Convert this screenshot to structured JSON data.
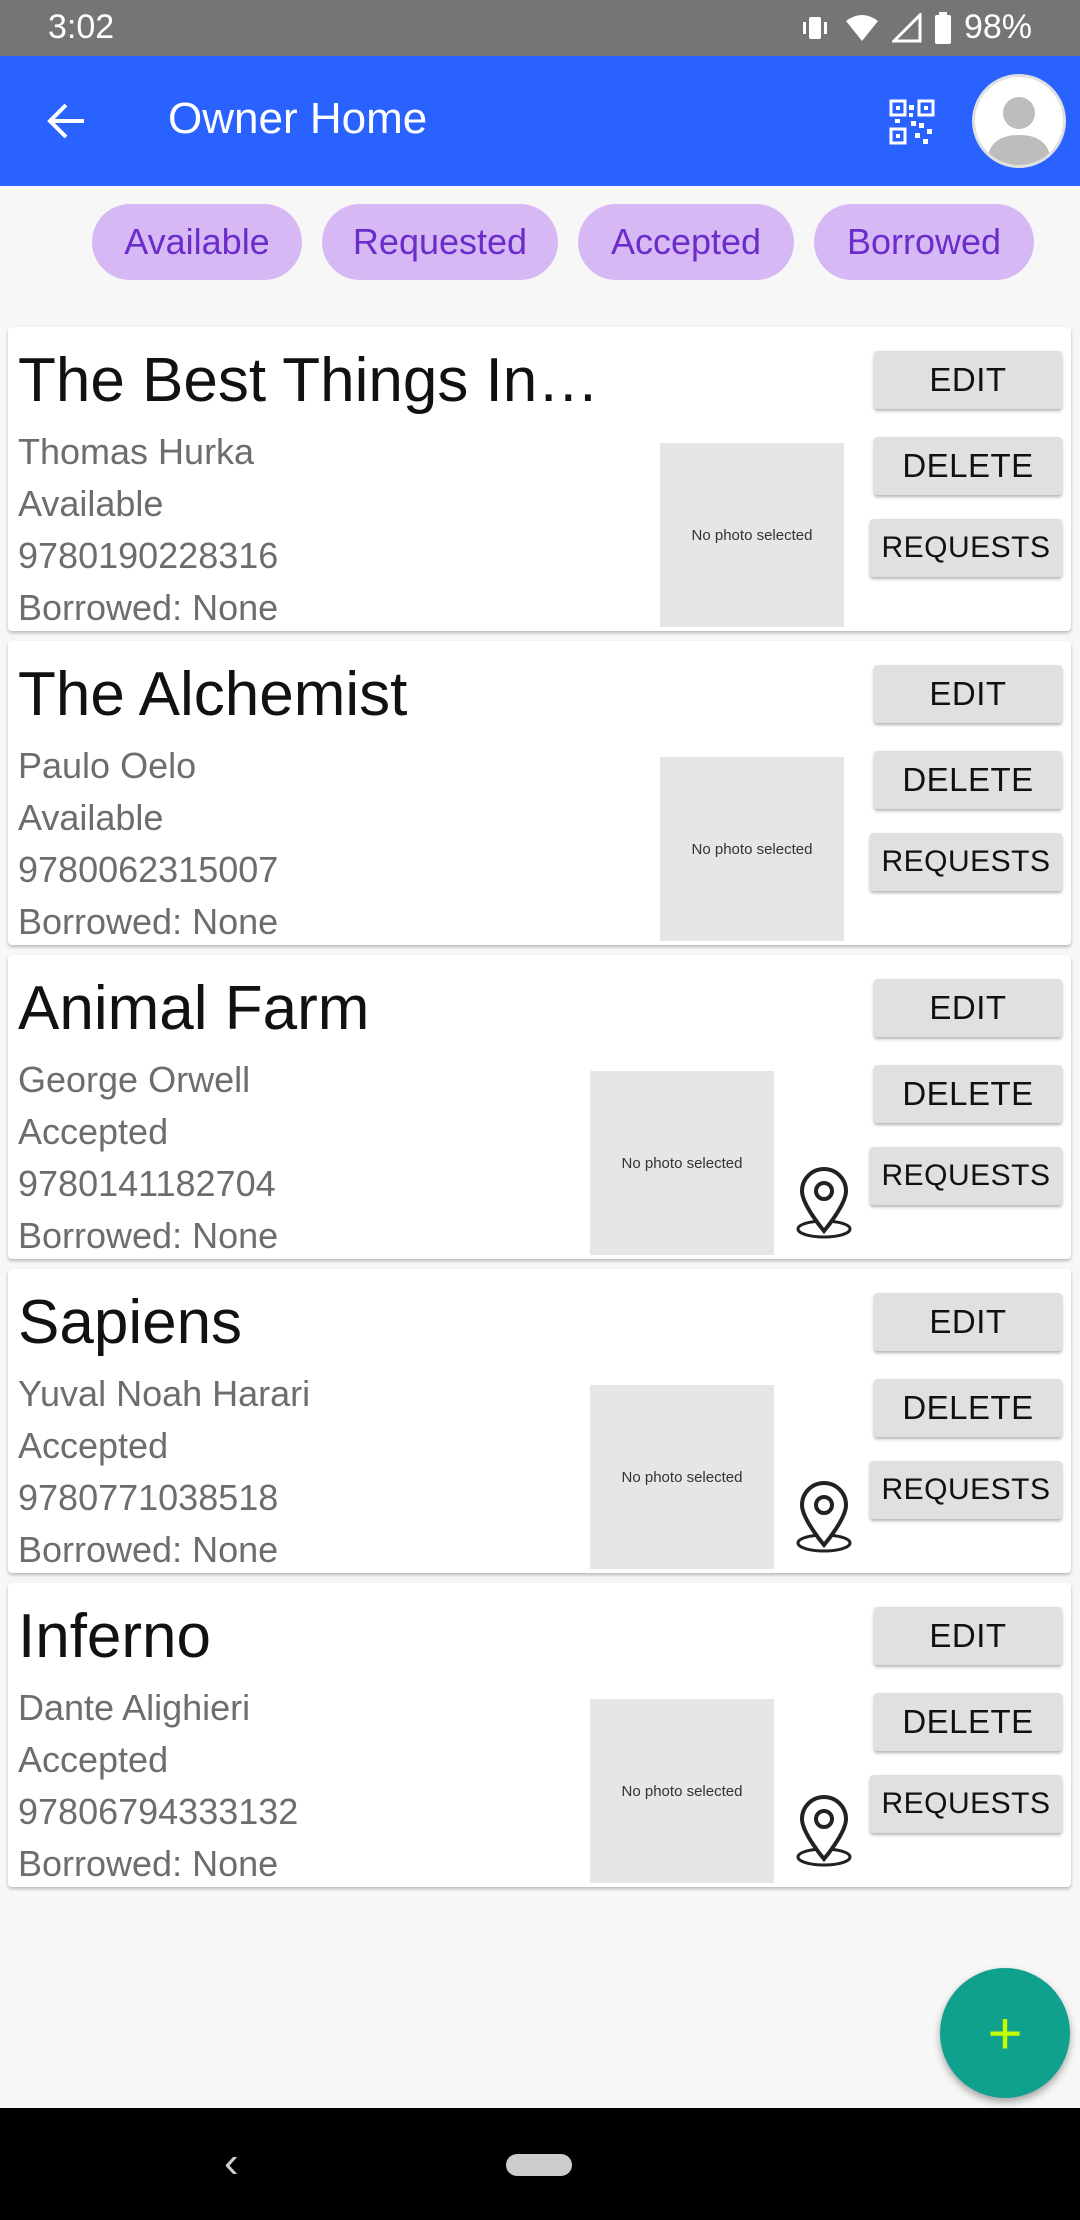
{
  "status": {
    "time": "3:02",
    "battery": "98%"
  },
  "appbar": {
    "title": "Owner Home"
  },
  "filters": [
    "Available",
    "Requested",
    "Accepted",
    "Borrowed"
  ],
  "buttons": {
    "edit": "EDIT",
    "delete": "DELETE",
    "requests": "REQUESTS"
  },
  "photo_placeholder": "No photo selected",
  "books": [
    {
      "title": "The Best Things In…",
      "author": "Thomas Hurka",
      "status": "Available",
      "isbn": "9780190228316",
      "borrowed": "Borrowed: None"
    },
    {
      "title": "The Alchemist",
      "author": "Paulo Oelo",
      "status": "Available",
      "isbn": "9780062315007",
      "borrowed": "Borrowed: None"
    },
    {
      "title": "Animal Farm",
      "author": "George Orwell",
      "status": "Accepted",
      "isbn": "9780141182704",
      "borrowed": "Borrowed: None"
    },
    {
      "title": "Sapiens",
      "author": "Yuval Noah Harari",
      "status": "Accepted",
      "isbn": "9780771038518",
      "borrowed": "Borrowed: None"
    },
    {
      "title": "Inferno",
      "author": "Dante Alighieri",
      "status": "Accepted",
      "isbn": "97806794333132",
      "borrowed": "Borrowed: None"
    }
  ],
  "fab": {
    "label": "+"
  },
  "colors": {
    "appbar": "#2962ff",
    "chip_bg": "#d6b8f5",
    "chip_text": "#6c2cc9",
    "fab": "#10a08e",
    "fab_icon": "#c6ff00"
  },
  "icons": [
    "back-arrow-icon",
    "qr-code-icon",
    "avatar-icon",
    "location-pin-icon",
    "plus-icon"
  ]
}
